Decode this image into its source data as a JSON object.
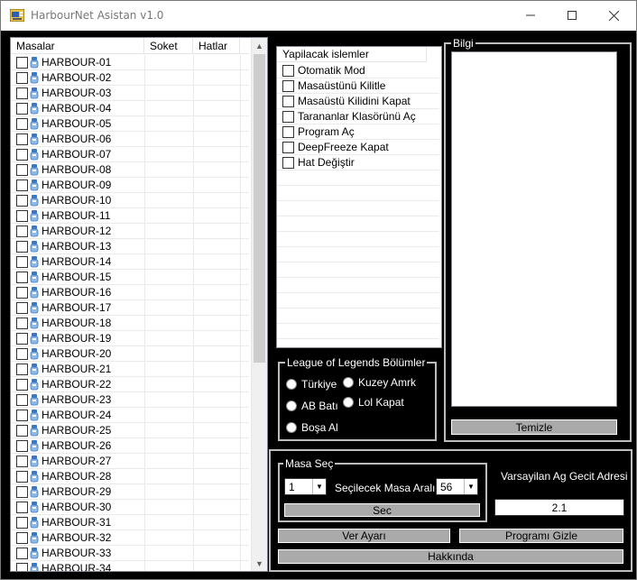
{
  "window": {
    "title": "HarbourNet Asistan v1.0"
  },
  "list": {
    "columns": [
      "Masalar",
      "Soket",
      "Hatlar"
    ],
    "rows": [
      "HARBOUR-01",
      "HARBOUR-02",
      "HARBOUR-03",
      "HARBOUR-04",
      "HARBOUR-05",
      "HARBOUR-06",
      "HARBOUR-07",
      "HARBOUR-08",
      "HARBOUR-09",
      "HARBOUR-10",
      "HARBOUR-11",
      "HARBOUR-12",
      "HARBOUR-13",
      "HARBOUR-14",
      "HARBOUR-15",
      "HARBOUR-16",
      "HARBOUR-17",
      "HARBOUR-18",
      "HARBOUR-19",
      "HARBOUR-20",
      "HARBOUR-21",
      "HARBOUR-22",
      "HARBOUR-23",
      "HARBOUR-24",
      "HARBOUR-25",
      "HARBOUR-26",
      "HARBOUR-27",
      "HARBOUR-28",
      "HARBOUR-29",
      "HARBOUR-30",
      "HARBOUR-31",
      "HARBOUR-32",
      "HARBOUR-33",
      "HARBOUR-34"
    ]
  },
  "actions": {
    "header": "Yapilacak islemler",
    "items": [
      "Otomatik Mod",
      "Masaüstünü Kilitle",
      "Masaüstü Kilidini Kapat",
      "Tarananlar Klasörünü Aç",
      "Program Aç",
      "DeepFreeze Kapat",
      "Hat Değiştir"
    ]
  },
  "lol": {
    "title": "League of Legends Bölümler",
    "options": [
      "Türkiye",
      "Kuzey Amrk",
      "AB Batı",
      "Lol Kapat",
      "Boşa Al"
    ]
  },
  "bilgi": {
    "title": "Bilgi",
    "clear_label": "Temizle"
  },
  "masa": {
    "title": "Masa Seç",
    "from_value": "1",
    "range_label": "Seçilecek Masa Aralığı",
    "to_value": "56",
    "select_label": "Sec"
  },
  "gateway": {
    "label": "Varsayilan Ag Gecit Adresi",
    "value": "2.1"
  },
  "buttons": {
    "ver_ayari": "Ver Ayarı",
    "programi_gizle": "Programı Gizle",
    "hakkinda": "Hakkında"
  }
}
